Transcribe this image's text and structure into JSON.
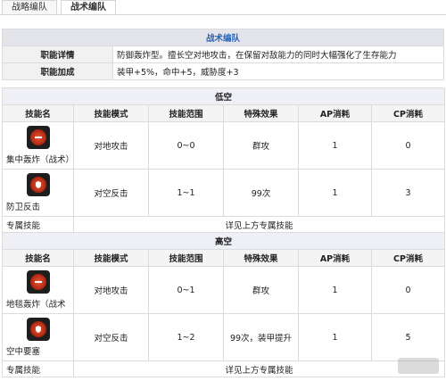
{
  "tabs": [
    "战略编队",
    "战术编队"
  ],
  "info": {
    "title": "战术编队",
    "rows": [
      {
        "label": "职能详情",
        "value": "防御轰炸型。擅长空对地攻击，在保留对敌能力的同时大幅强化了生存能力"
      },
      {
        "label": "职能加成",
        "value": "装甲+5%，命中+5，威胁度+3"
      }
    ]
  },
  "headers": [
    "技能名",
    "技能模式",
    "技能范围",
    "特殊效果",
    "AP消耗",
    "CP消耗"
  ],
  "sections": [
    {
      "title": "低空",
      "skills": [
        {
          "name": "集中轰炸（战术）",
          "icon": "bomb-icon",
          "mode": "对地攻击",
          "range": "0~0",
          "effect": "群攻",
          "ap": "1",
          "cp": "0"
        },
        {
          "name": "防卫反击",
          "icon": "shield-icon",
          "mode": "对空反击",
          "range": "1~1",
          "effect": "99次",
          "ap": "1",
          "cp": "3"
        }
      ],
      "exclusive": {
        "label": "专属技能",
        "value": "详见上方专属技能"
      }
    },
    {
      "title": "高空",
      "skills": [
        {
          "name": "地毯轰炸（战术",
          "icon": "bomb-icon",
          "mode": "对地攻击",
          "range": "0~1",
          "effect": "群攻",
          "ap": "1",
          "cp": "0"
        },
        {
          "name": "空中要塞",
          "icon": "shield-icon",
          "mode": "对空反击",
          "range": "1~2",
          "effect": "99次，装甲提升",
          "ap": "1",
          "cp": "5"
        }
      ],
      "exclusive": {
        "label": "专属技能",
        "value": "详见上方专属技能"
      }
    }
  ]
}
